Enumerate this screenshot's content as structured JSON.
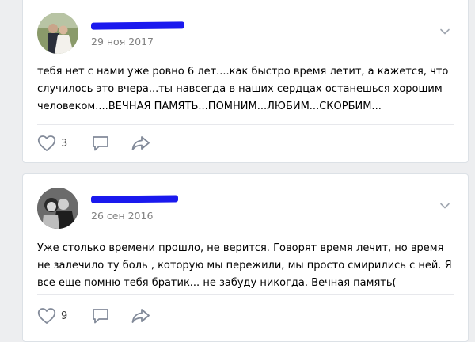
{
  "posts": [
    {
      "date": "29 ноя 2017",
      "text": "тебя нет с нами уже ровно 6 лет....как быстро время летит, а кажется, что случилось это вчера...ты навсегда в наших сердцах останешься хорошим человеком....ВЕЧНАЯ ПАМЯТЬ...ПОМНИМ...ЛЮБИМ...СКОРБИМ...",
      "likes": "3"
    },
    {
      "date": "26 сен 2016",
      "text": "Уже столько времени прошло, не верится. Говорят время лечит, но время не залечило ту боль , которую мы пережили, мы просто смирились с ней. Я все еще помню тебя братик... не забуду никогда. Вечная память(",
      "likes": "9"
    }
  ],
  "icons": {
    "like": "heart-icon",
    "comment": "comment-icon",
    "share": "share-icon",
    "menu": "chevron-down-icon"
  },
  "colors": {
    "background": "#edeef0",
    "card": "#ffffff",
    "redaction": "#1a19ee",
    "date": "#828282",
    "icon": "#828a99"
  }
}
